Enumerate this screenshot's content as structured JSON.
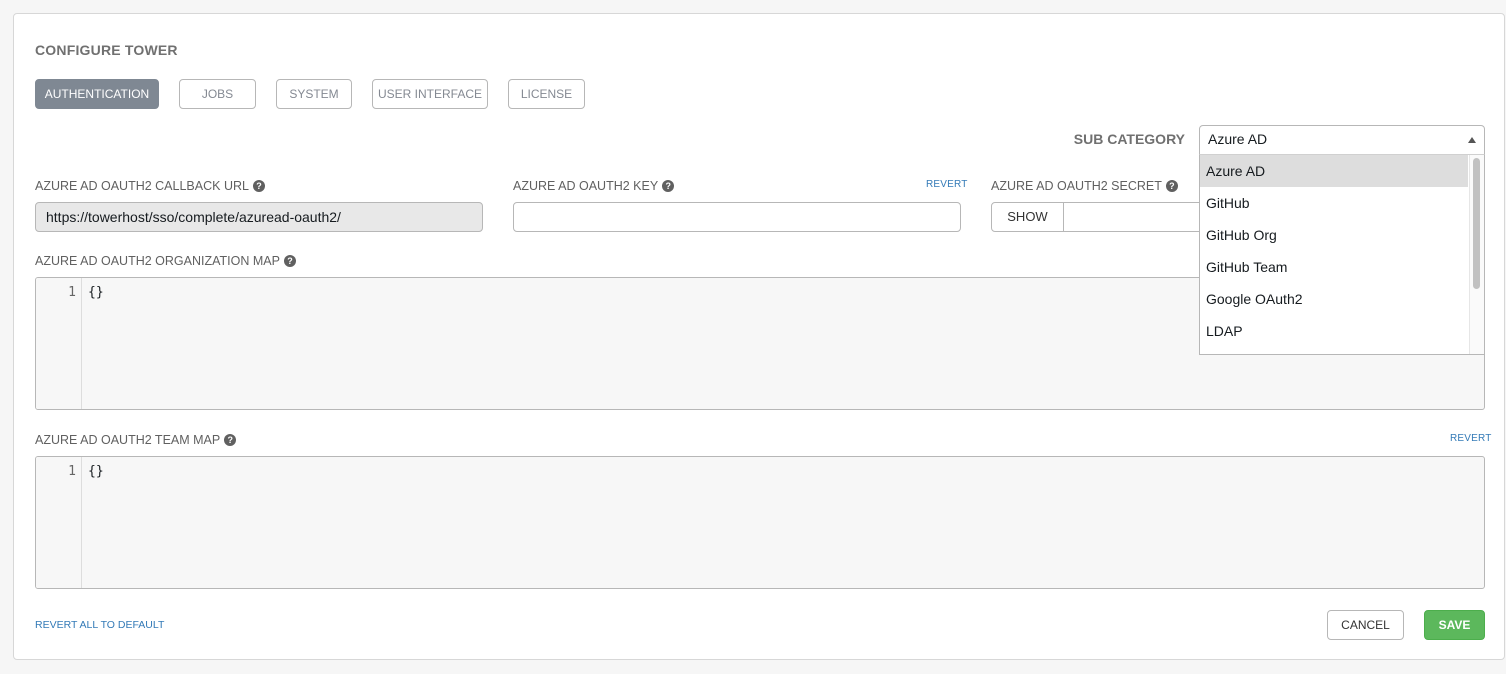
{
  "page": {
    "title": "CONFIGURE TOWER"
  },
  "tabs": [
    {
      "label": "AUTHENTICATION",
      "active": true
    },
    {
      "label": "JOBS",
      "active": false
    },
    {
      "label": "SYSTEM",
      "active": false
    },
    {
      "label": "USER INTERFACE",
      "active": false
    },
    {
      "label": "LICENSE",
      "active": false
    }
  ],
  "sub_category": {
    "label": "SUB CATEGORY",
    "selected": "Azure AD",
    "options": [
      "Azure AD",
      "GitHub",
      "GitHub Org",
      "GitHub Team",
      "Google OAuth2",
      "LDAP"
    ]
  },
  "fields": {
    "callback_url": {
      "label": "AZURE AD OAUTH2 CALLBACK URL",
      "value": "https://towerhost/sso/complete/azuread-oauth2/"
    },
    "key": {
      "label": "AZURE AD OAUTH2 KEY",
      "revert": "REVERT",
      "value": ""
    },
    "secret": {
      "label": "AZURE AD OAUTH2 SECRET",
      "show_label": "SHOW"
    },
    "org_map": {
      "label": "AZURE AD OAUTH2 ORGANIZATION MAP",
      "line_number": "1",
      "code": "{}"
    },
    "team_map": {
      "label": "AZURE AD OAUTH2 TEAM MAP",
      "revert": "REVERT",
      "line_number": "1",
      "code": "{}"
    }
  },
  "footer": {
    "revert_all": "REVERT ALL TO DEFAULT",
    "cancel": "CANCEL",
    "save": "SAVE"
  },
  "icons": {
    "help": "question-circle-icon",
    "caret": "caret-up-icon"
  },
  "colors": {
    "active_tab": "#7f8893",
    "save": "#5cb85c",
    "link": "#337ab7"
  }
}
